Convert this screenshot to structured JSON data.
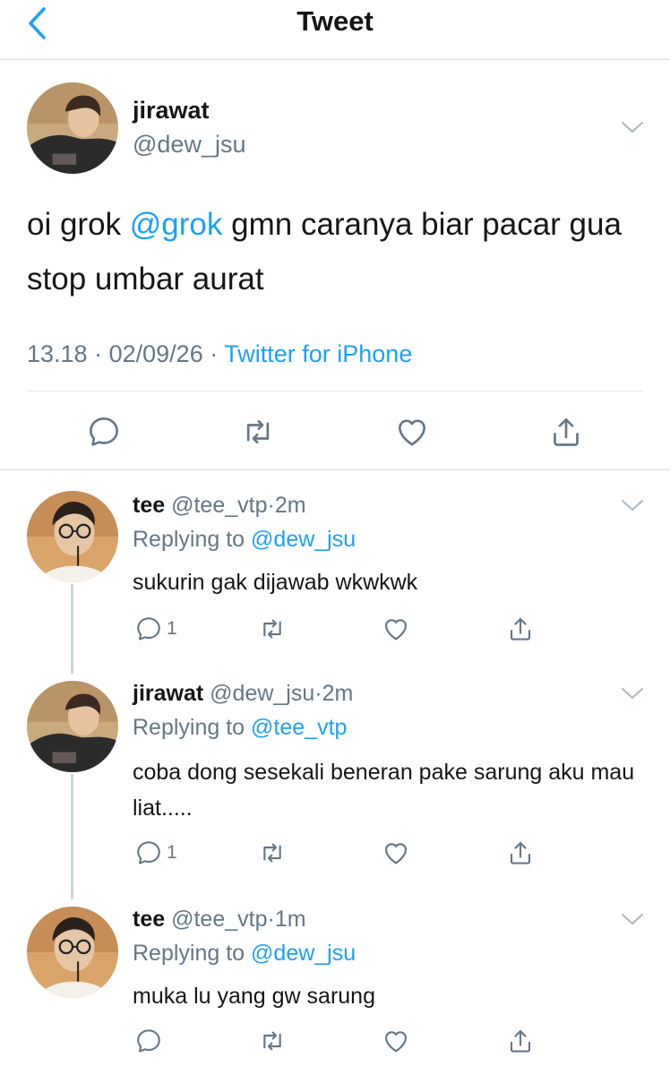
{
  "header": {
    "title": "Tweet"
  },
  "main_tweet": {
    "name": "jirawat",
    "handle": "@dew_jsu",
    "text_before": "oi grok ",
    "mention": "@grok",
    "text_after": " gmn caranya biar pacar gua stop umbar aurat",
    "time": "13.18",
    "date": "02/09/26",
    "source": "Twitter for iPhone",
    "sep": "·"
  },
  "replies": [
    {
      "name": "tee",
      "handle": "@tee_vtp",
      "time": "2m",
      "replying_label": "Replying to",
      "replying_to": "@dew_jsu",
      "text": "sukurin gak dijawab wkwkwk",
      "reply_count": "1"
    },
    {
      "name": "jirawat",
      "handle": "@dew_jsu",
      "time": "2m",
      "replying_label": "Replying to",
      "replying_to": "@tee_vtp",
      "text": "coba dong sesekali beneran pake sarung aku mau liat.....",
      "reply_count": "1"
    },
    {
      "name": "tee",
      "handle": "@tee_vtp",
      "time": "1m",
      "replying_label": "Replying to",
      "replying_to": "@dew_jsu",
      "text": "muka lu yang gw sarung",
      "reply_count": ""
    }
  ],
  "icons": [
    "back-chevron-icon",
    "chevron-down-icon",
    "reply-icon",
    "retweet-icon",
    "like-icon",
    "share-icon"
  ],
  "colors": {
    "accent": "#1da1f2",
    "secondary_text": "#657786",
    "icon_grey": "#657786",
    "divider": "#e1e8ed"
  }
}
